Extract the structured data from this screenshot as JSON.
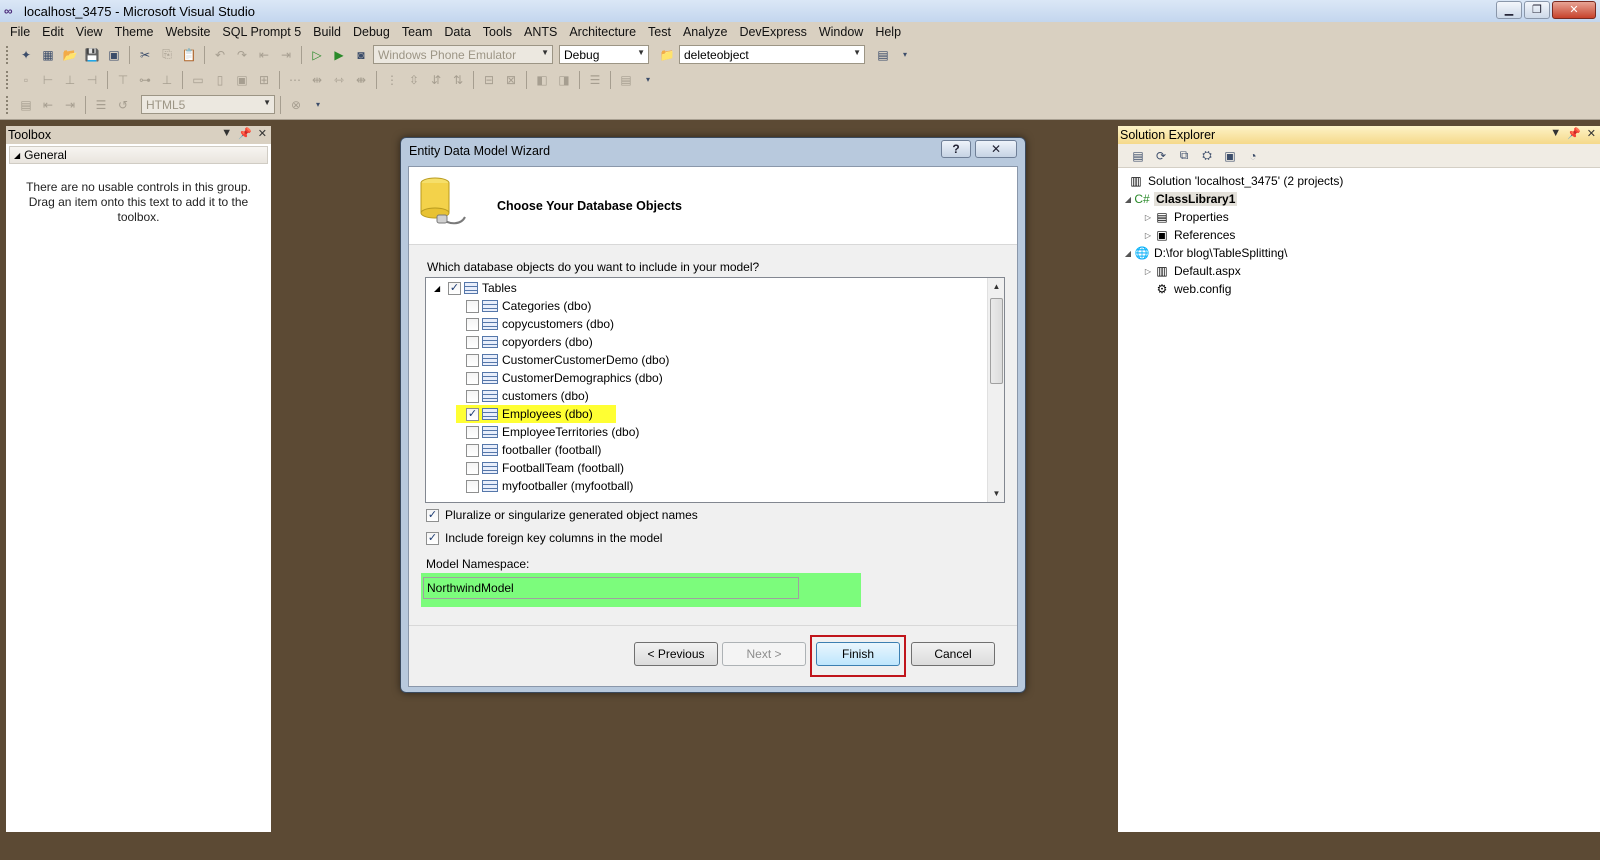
{
  "window": {
    "title": "localhost_3475 - Microsoft Visual Studio",
    "controls": [
      "minimize-icon",
      "restore-icon",
      "close-icon"
    ]
  },
  "menu": [
    "File",
    "Edit",
    "View",
    "Theme",
    "Website",
    "SQL Prompt 5",
    "Build",
    "Debug",
    "Team",
    "Data",
    "Tools",
    "ANTS",
    "Architecture",
    "Test",
    "Analyze",
    "DevExpress",
    "Window",
    "Help"
  ],
  "toolbar": {
    "target_device": "Windows Phone Emulator",
    "configuration": "Debug",
    "find_text": "deleteobject",
    "doc_schema": "HTML5"
  },
  "toolbox": {
    "title": "Toolbox",
    "group": "General",
    "empty_message": "There are no usable controls in this group. Drag an item onto this text to add it to the toolbox."
  },
  "solution_explorer": {
    "title": "Solution Explorer",
    "nodes": [
      {
        "label": "Solution 'localhost_3475' (2 projects)"
      },
      {
        "label": "ClassLibrary1"
      },
      {
        "label": "Properties"
      },
      {
        "label": "References"
      },
      {
        "label": "D:\\for blog\\TableSplitting\\"
      },
      {
        "label": "Default.aspx"
      },
      {
        "label": "web.config"
      }
    ]
  },
  "dialog": {
    "title": "Entity Data Model Wizard",
    "help_label": "?",
    "heading": "Choose Your Database Objects",
    "question": "Which database objects do you want to include in your model?",
    "tree": {
      "root": {
        "label": "Tables",
        "checked": true
      },
      "tables": [
        {
          "label": "Categories (dbo)",
          "checked": false
        },
        {
          "label": "copycustomers (dbo)",
          "checked": false
        },
        {
          "label": "copyorders (dbo)",
          "checked": false
        },
        {
          "label": "CustomerCustomerDemo (dbo)",
          "checked": false
        },
        {
          "label": "CustomerDemographics (dbo)",
          "checked": false
        },
        {
          "label": "customers (dbo)",
          "checked": false
        },
        {
          "label": "Employees (dbo)",
          "checked": true,
          "highlighted": true
        },
        {
          "label": "EmployeeTerritories (dbo)",
          "checked": false
        },
        {
          "label": "footballer (football)",
          "checked": false
        },
        {
          "label": "FootballTeam (football)",
          "checked": false
        },
        {
          "label": "myfootballer (myfootball)",
          "checked": false
        }
      ]
    },
    "options": [
      {
        "label": "Pluralize or singularize generated object names",
        "checked": true
      },
      {
        "label": "Include foreign key columns in the model",
        "checked": true
      }
    ],
    "namespace_label": "Model Namespace:",
    "namespace_value": "NorthwindModel",
    "buttons": {
      "previous": "< Previous",
      "next": "Next >",
      "finish": "Finish",
      "cancel": "Cancel"
    }
  },
  "colors": {
    "workspace": "#5c4a34",
    "chrome": "#d9d0c1",
    "highlight_yellow": "#ffff33",
    "highlight_green": "#7cfc7c",
    "finish_outline": "#c0151b"
  }
}
